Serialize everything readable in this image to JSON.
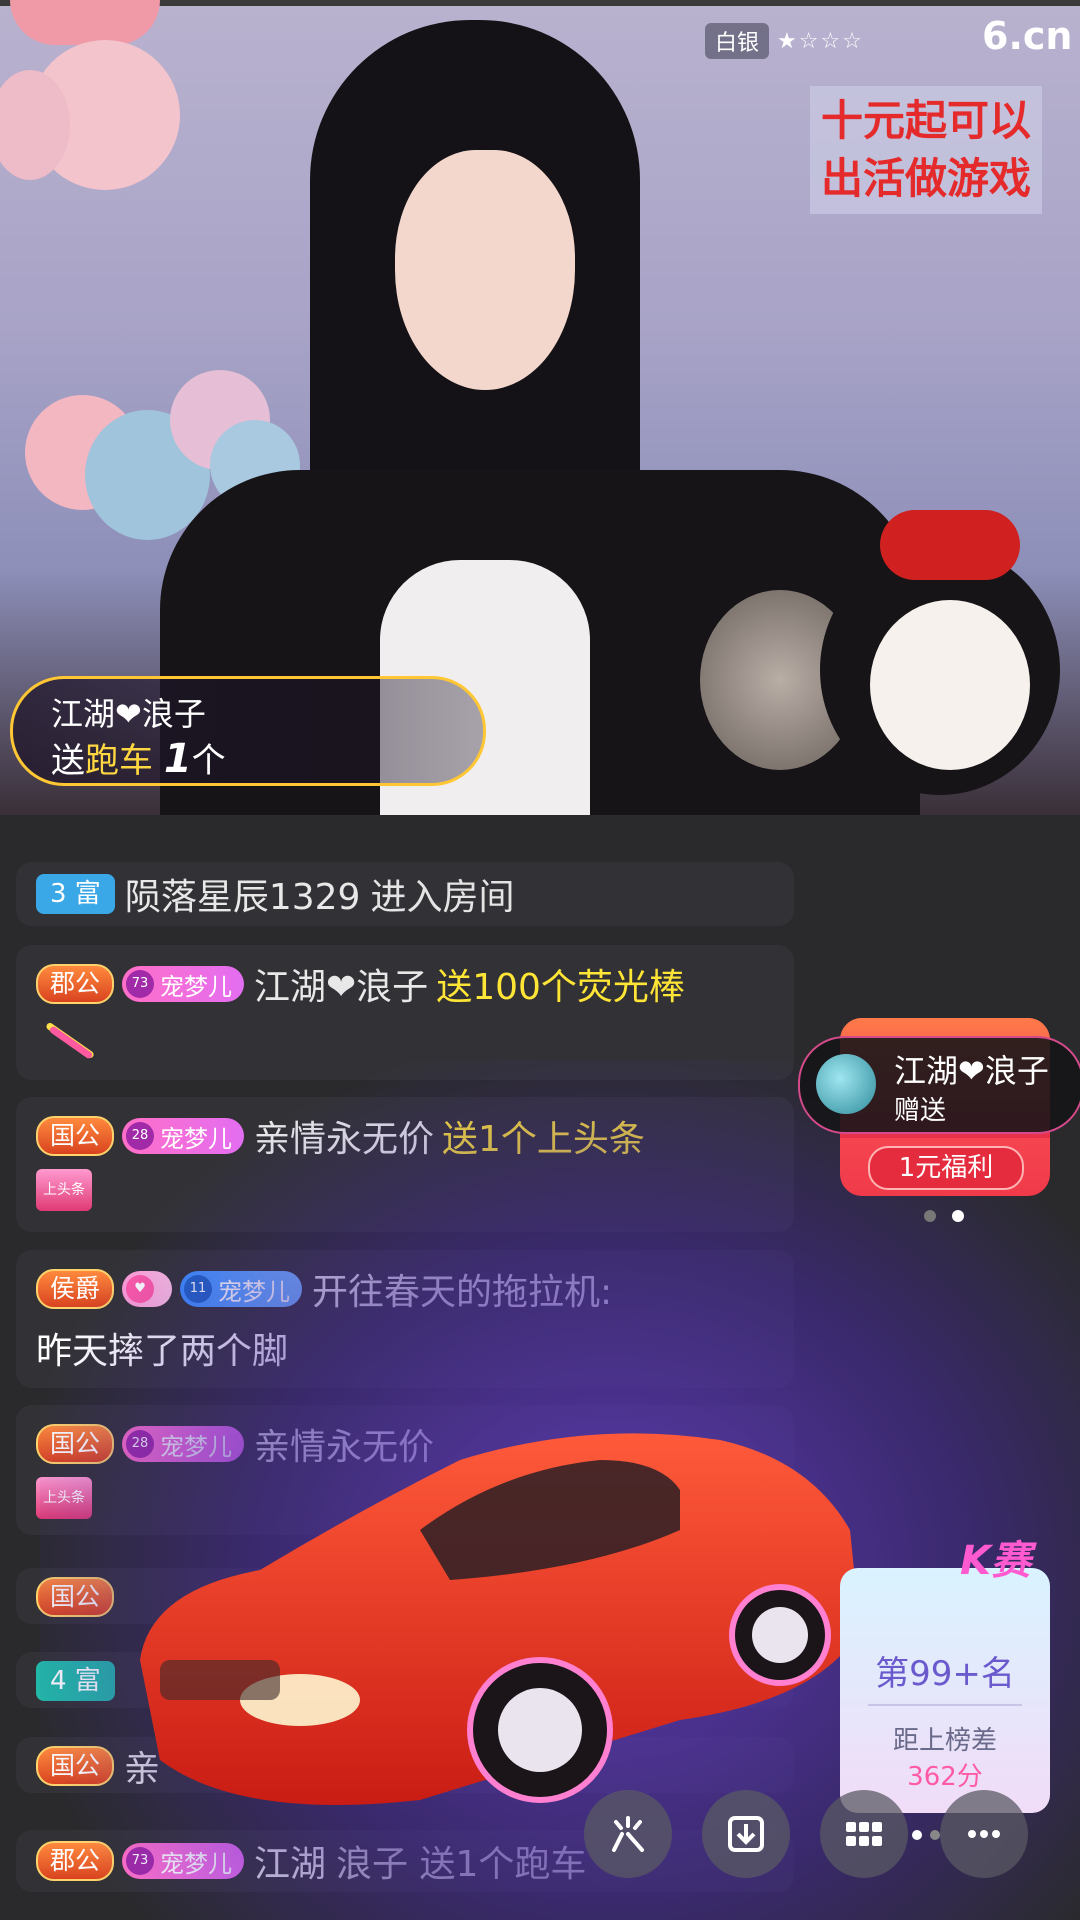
{
  "video": {
    "quality_badge": "白银",
    "stars": "★☆☆☆",
    "logo": "6.cn",
    "notice_line1": "十元起可以",
    "notice_line2": "出活做游戏",
    "gift_banner": {
      "user": "江湖❤浪子",
      "send": "送",
      "gift_name": "跑车",
      "count": "1",
      "unit": "个"
    }
  },
  "chat": {
    "messages": [
      {
        "level": "3 富",
        "user": "陨落星辰1329",
        "action": "进入房间"
      },
      {
        "rank": "郡公",
        "fan_level": "73",
        "fan_name": "宠梦儿",
        "user": "江湖❤浪子",
        "gift": "送100个荧光棒"
      },
      {
        "rank": "国公",
        "fan_level": "28",
        "fan_name": "宠梦儿",
        "user": "亲情永无价",
        "gift": "送1个上头条",
        "gift_icon": "上头条"
      },
      {
        "rank": "侯爵",
        "fan_level": "11",
        "fan_name": "宠梦儿",
        "user": "开往春天的拖拉机:",
        "text": "昨天摔了两个脚"
      },
      {
        "rank": "国公",
        "fan_level": "28",
        "fan_name": "宠梦儿",
        "user": "亲情永无价",
        "gift_icon": "上头条"
      },
      {
        "rank": "国公"
      },
      {
        "level": "4 富"
      },
      {
        "rank": "国公",
        "user": "亲"
      },
      {
        "rank": "郡公",
        "fan_level": "73",
        "fan_name": "宠梦儿",
        "user": "江湖",
        "gift": "浪子 送1个跑车"
      }
    ]
  },
  "side_gift": {
    "user": "江湖❤浪子",
    "action": "赠送",
    "button": "1元福利"
  },
  "rank_card": {
    "title": "K赛",
    "rank": "第99+名",
    "diff_label": "距上榜差",
    "diff_value": "362分"
  },
  "controls": [
    {
      "icon": "share-icon"
    },
    {
      "icon": "download-icon"
    },
    {
      "icon": "grid-icon"
    },
    {
      "icon": "more-icon"
    }
  ]
}
